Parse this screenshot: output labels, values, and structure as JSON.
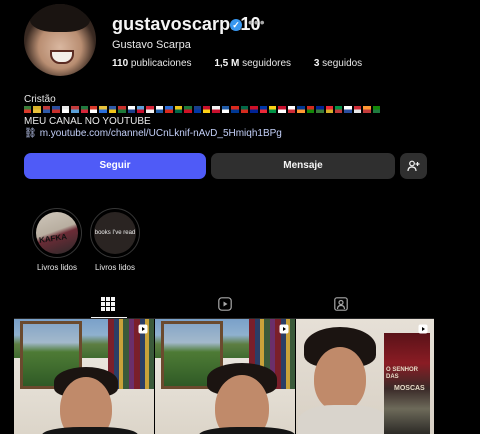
{
  "profile": {
    "username": "gustavoscarpa10",
    "full_name": "Gustavo Scarpa",
    "verified": true,
    "stats": {
      "posts": "110",
      "posts_label": "publicaciones",
      "followers": "1,5 M",
      "followers_label": "seguidores",
      "following": "3",
      "following_label": "seguidos"
    },
    "bio": {
      "line1": "Cristão",
      "flags": [
        "#3a7d3a",
        "#d8b12a",
        "#c23b3b",
        "#2b4e9e",
        "#e8e8e8",
        "#c23b3b",
        "#1f7a3f",
        "#d93a2b",
        "#e8c23a",
        "#2e5aa8",
        "#c9302c",
        "#ffffff",
        "#5aa0d8",
        "#d8263a",
        "#ffffff",
        "#2a6fdb",
        "#f0c419",
        "#1c7a3a",
        "#1a3e8a",
        "#c8102e",
        "#f2f2f2",
        "#1f5aa6",
        "#da291c",
        "#006847",
        "#ce1126",
        "#0038a8",
        "#fcd116",
        "#c8102e",
        "#ffffff",
        "#003893",
        "#d52b1e",
        "#002395",
        "#ed2939",
        "#009246",
        "#ffffff",
        "#ce2b37",
        "#ff9933",
        "#138808"
      ],
      "line2": "MEU CANAL NO YOUTUBE",
      "link": "m.youtube.com/channel/UCnLknif-nAvD_5Hmiqh1BPg"
    }
  },
  "actions": {
    "follow_label": "Seguir",
    "message_label": "Mensaje"
  },
  "highlights": [
    {
      "label": "Livros lidos",
      "cover_text": "KAFKA"
    },
    {
      "label": "Livros lidos",
      "cover_text": "books I've read"
    }
  ],
  "posts": [
    {
      "type": "reel"
    },
    {
      "type": "reel"
    },
    {
      "type": "reel",
      "book_title_1": "O SENHOR DAS",
      "book_title_2": "MOSCAS"
    }
  ]
}
